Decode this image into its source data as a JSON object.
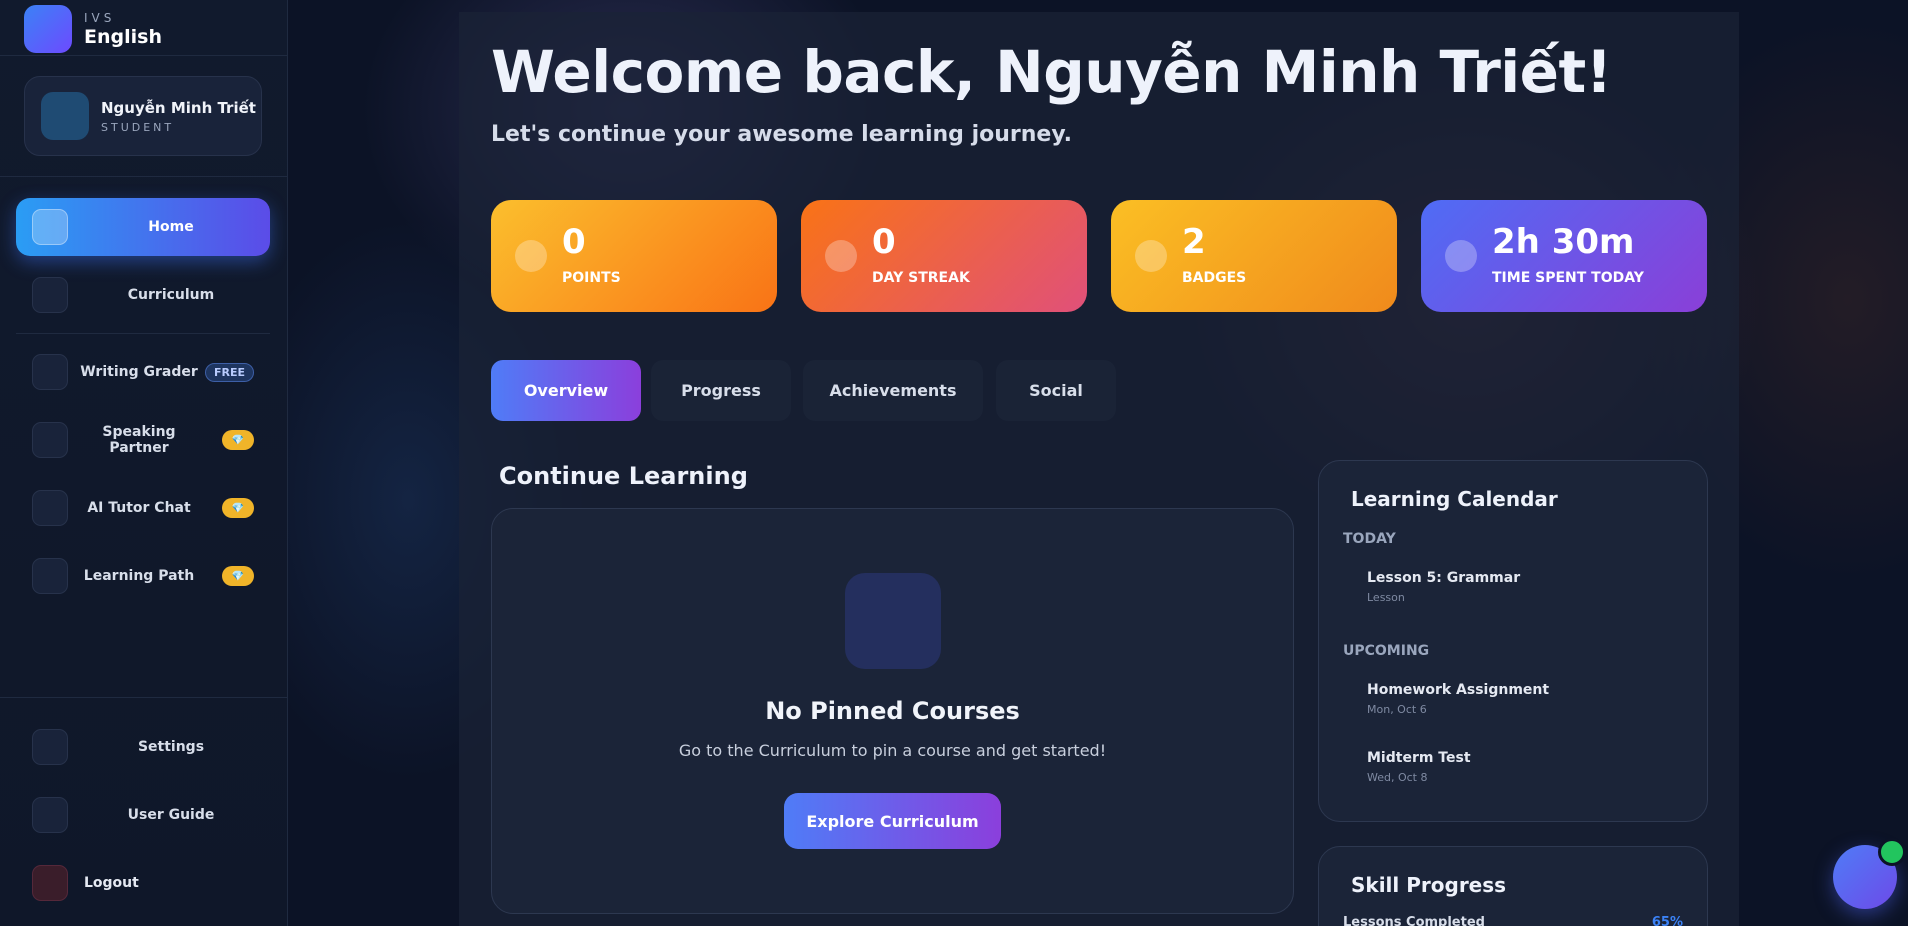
{
  "brand": {
    "small": "IVS",
    "big": "English"
  },
  "profile": {
    "name": "Nguyễn Minh Triết",
    "role": "STUDENT"
  },
  "nav": {
    "home": "Home",
    "curriculum": "Curriculum",
    "writing_grader": "Writing Grader",
    "writing_grader_badge": "FREE",
    "speaking_partner": "Speaking Partner",
    "ai_tutor_chat": "AI Tutor Chat",
    "learning_path": "Learning Path",
    "premium_badge": "💎",
    "settings": "Settings",
    "user_guide": "User Guide",
    "logout": "Logout"
  },
  "header": {
    "welcome": "Welcome back, Nguyễn Minh Triết!",
    "subtitle": "Let's continue your awesome learning journey."
  },
  "stats": [
    {
      "value": "0",
      "label": "POINTS"
    },
    {
      "value": "0",
      "label": "DAY STREAK"
    },
    {
      "value": "2",
      "label": "BADGES"
    },
    {
      "value": "2h 30m",
      "label": "TIME SPENT TODAY"
    }
  ],
  "tabs": [
    "Overview",
    "Progress",
    "Achievements",
    "Social"
  ],
  "continue_learning": {
    "title": "Continue Learning",
    "empty_title": "No Pinned Courses",
    "empty_text": "Go to the Curriculum to pin a course and get started!",
    "button": "Explore Curriculum"
  },
  "calendar": {
    "title": "Learning Calendar",
    "today_label": "TODAY",
    "today_items": [
      {
        "title": "Lesson 5: Grammar",
        "sub": "Lesson"
      }
    ],
    "upcoming_label": "UPCOMING",
    "upcoming_items": [
      {
        "title": "Homework Assignment",
        "sub": "Mon, Oct 6"
      },
      {
        "title": "Midterm Test",
        "sub": "Wed, Oct 8"
      }
    ]
  },
  "skill_progress": {
    "title": "Skill Progress",
    "row_label": "Lessons Completed",
    "row_value": "65%"
  },
  "colors": {
    "accent_blue": "#4f7cf7",
    "accent_purple": "#8b3fdc",
    "points": "#f97316",
    "streak": "#e0507a",
    "badges": "#f08a1c",
    "time": "#6d4ae8",
    "online": "#22c55e"
  }
}
